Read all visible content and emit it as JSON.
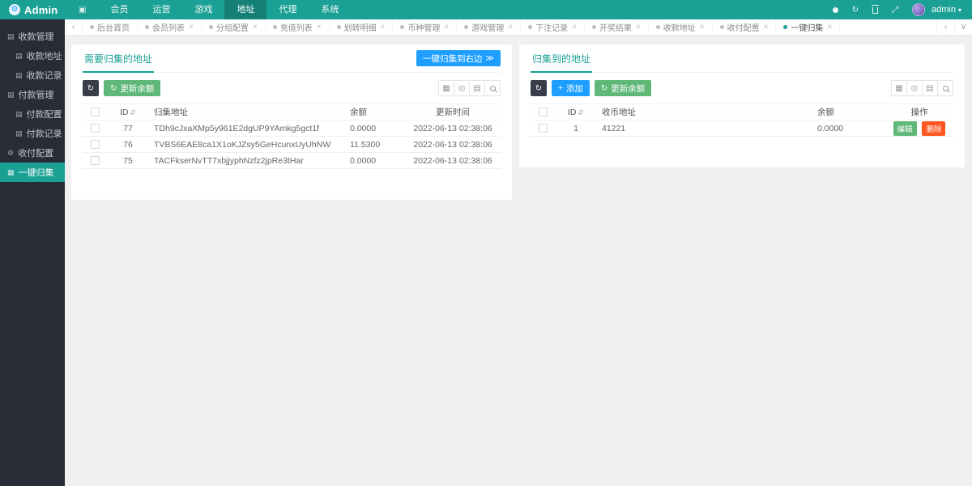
{
  "brand": "Admin",
  "navbar": {
    "menu": [
      {
        "label": "会员"
      },
      {
        "label": "运营"
      },
      {
        "label": "游戏"
      },
      {
        "label": "地址"
      },
      {
        "label": "代理"
      },
      {
        "label": "系统"
      }
    ],
    "active_item": "地址",
    "username": "admin"
  },
  "tabbar": {
    "tabs": [
      {
        "label": "后台首页"
      },
      {
        "label": "会员列表"
      },
      {
        "label": "分组配置"
      },
      {
        "label": "充值列表"
      },
      {
        "label": "划转明细"
      },
      {
        "label": "币种管理"
      },
      {
        "label": "游戏管理"
      },
      {
        "label": "下注记录"
      },
      {
        "label": "开奖结果"
      },
      {
        "label": "收款地址"
      },
      {
        "label": "收付配置"
      },
      {
        "label": "一键归集"
      }
    ],
    "active_tab": "一键归集"
  },
  "sidebar": {
    "items": [
      {
        "label": "收款管理"
      },
      {
        "label": "收款地址"
      },
      {
        "label": "收款记录"
      },
      {
        "label": "付款管理"
      },
      {
        "label": "付款配置"
      },
      {
        "label": "付款记录"
      },
      {
        "label": "收付配置"
      },
      {
        "label": "一键归集"
      }
    ],
    "active_item": "一键归集"
  },
  "left_panel": {
    "title": "需要归集的地址",
    "collect_button_label": "一键归集到右边",
    "refresh_balance_label": "更新余额",
    "table": {
      "columns": {
        "id": "ID",
        "address": "归集地址",
        "balance": "余额",
        "updated": "更新时间"
      },
      "rows": [
        {
          "id": "77",
          "address": "TDh9cJxaXMp5y961E2dgUP9YAmkg5gct1f",
          "balance": "0.0000",
          "updated": "2022-06-13 02:38:06"
        },
        {
          "id": "76",
          "address": "TVBS6EAE8ca1X1oKJZsy5GeHcunxUyUhNW",
          "balance": "11.5300",
          "updated": "2022-06-13 02:38:06"
        },
        {
          "id": "75",
          "address": "TACFkserNvTT7xbjjyphNzfz2jpRe3tHar",
          "balance": "0.0000",
          "updated": "2022-06-13 02:38:06"
        }
      ]
    }
  },
  "right_panel": {
    "title": "归集到的地址",
    "add_button_label": "添加",
    "refresh_balance_label": "更新余额",
    "table": {
      "columns": {
        "id": "ID",
        "address": "收币地址",
        "balance": "余额",
        "actions": "操作"
      },
      "rows": [
        {
          "id": "1",
          "address": "41221",
          "balance": "0.0000"
        }
      ],
      "action_labels": {
        "edit": "编辑",
        "delete": "删除"
      }
    }
  },
  "colors": {
    "accent": "#1aa094",
    "sidebar_bg": "#272c36",
    "blue": "#1E9FFF",
    "green": "#5FB878",
    "dark_button": "#393D49",
    "danger": "#FF5722"
  }
}
